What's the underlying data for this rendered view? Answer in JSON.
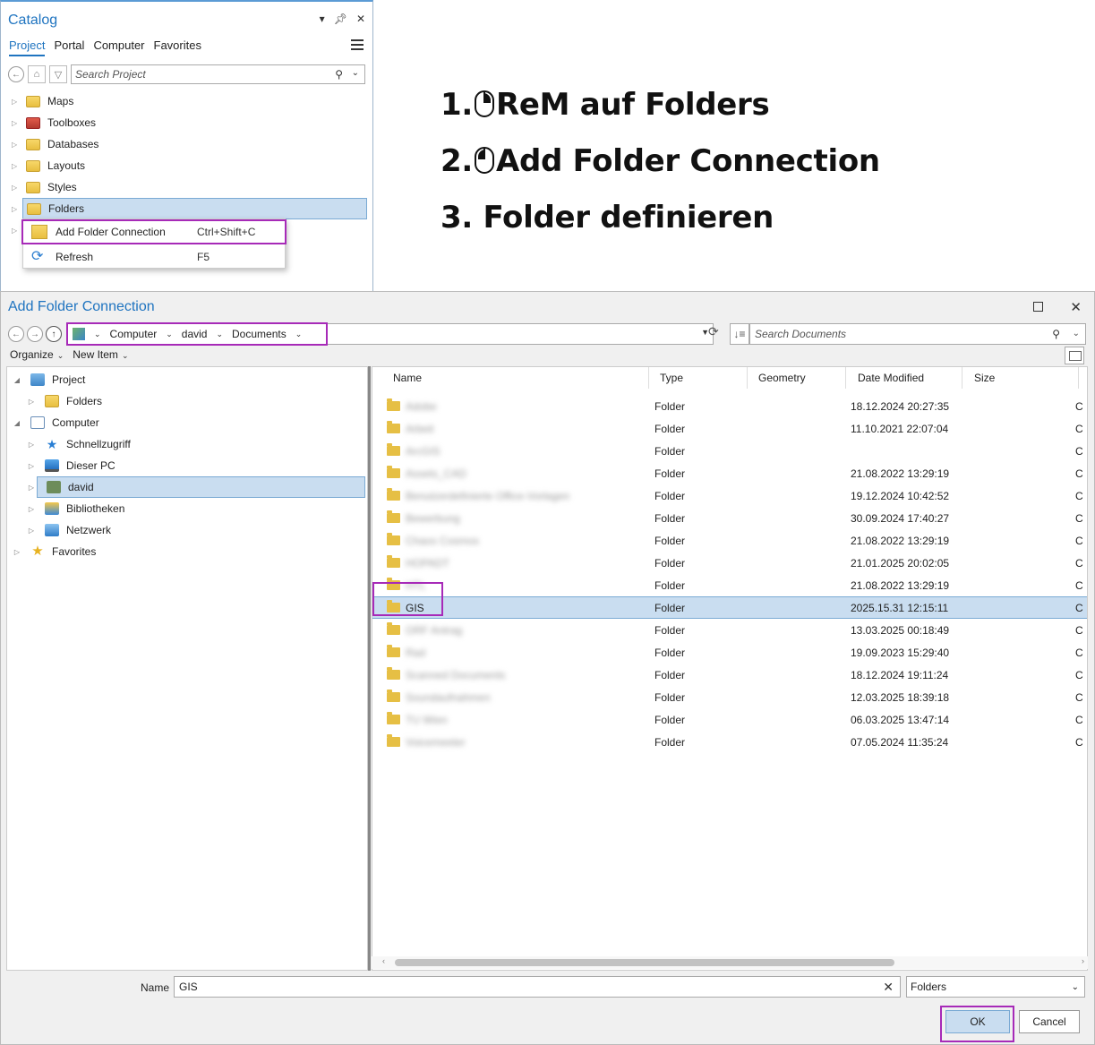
{
  "catalog": {
    "title": "Catalog",
    "tabs": [
      "Project",
      "Portal",
      "Computer",
      "Favorites"
    ],
    "search_placeholder": "Search Project",
    "items": [
      {
        "label": "Maps",
        "icon": "maps-folder-icon"
      },
      {
        "label": "Toolboxes",
        "icon": "toolboxes-folder-icon"
      },
      {
        "label": "Databases",
        "icon": "databases-folder-icon"
      },
      {
        "label": "Layouts",
        "icon": "layouts-folder-icon"
      },
      {
        "label": "Styles",
        "icon": "styles-folder-icon"
      },
      {
        "label": "Folders",
        "icon": "folders-folder-icon",
        "selected": true
      }
    ],
    "context_menu": [
      {
        "label": "Add Folder Connection",
        "shortcut": "Ctrl+Shift+C",
        "icon": "add-folder-icon",
        "highlighted": true
      },
      {
        "label": "Refresh",
        "shortcut": "F5",
        "icon": "refresh-icon"
      }
    ]
  },
  "instructions": {
    "step1": {
      "num": "1.",
      "text": "ReM auf Folders",
      "mouse": "right-click"
    },
    "step2": {
      "num": "2.",
      "text": "Add Folder Connection",
      "mouse": "left-click"
    },
    "step3": {
      "text": "3. Folder definieren"
    }
  },
  "dialog": {
    "title": "Add Folder Connection",
    "breadcrumb": [
      "Computer",
      "david",
      "Documents"
    ],
    "search_placeholder": "Search Documents",
    "toolbar": {
      "organize": "Organize",
      "new_item": "New Item"
    },
    "left_tree": [
      {
        "label": "Project",
        "level": 0,
        "expanded": true,
        "icon": "project-icon"
      },
      {
        "label": "Folders",
        "level": 1,
        "icon": "folder-icon"
      },
      {
        "label": "Computer",
        "level": 0,
        "expanded": true,
        "icon": "computer-icon"
      },
      {
        "label": "Schnellzugriff",
        "level": 1,
        "icon": "star-icon"
      },
      {
        "label": "Dieser PC",
        "level": 1,
        "icon": "pc-icon"
      },
      {
        "label": "david",
        "level": 1,
        "icon": "user-icon",
        "selected": true
      },
      {
        "label": "Bibliotheken",
        "level": 1,
        "icon": "library-icon"
      },
      {
        "label": "Netzwerk",
        "level": 1,
        "icon": "network-icon"
      },
      {
        "label": "Favorites",
        "level": 0,
        "icon": "favorites-star-icon"
      }
    ],
    "columns": [
      "Name",
      "Type",
      "Geometry",
      "Date Modified",
      "Size"
    ],
    "rows": [
      {
        "name": "Adobe",
        "type": "Folder",
        "date": "18.12.2024 20:27:35",
        "blurred": true
      },
      {
        "name": "Arbeit",
        "type": "Folder",
        "date": "11.10.2021 22:07:04",
        "blurred": true
      },
      {
        "name": "ArcGIS",
        "type": "Folder",
        "date": "",
        "blurred": true
      },
      {
        "name": "Assets_CAD",
        "type": "Folder",
        "date": "21.08.2022 13:29:19",
        "blurred": true
      },
      {
        "name": "Benutzerdefinierte Office-Vorlagen",
        "type": "Folder",
        "date": "19.12.2024 10:42:52",
        "blurred": true
      },
      {
        "name": "Bewerbung",
        "type": "Folder",
        "date": "30.09.2024 17:40:27",
        "blurred": true
      },
      {
        "name": "Chaos Cosmos",
        "type": "Folder",
        "date": "21.08.2022 13:29:19",
        "blurred": true
      },
      {
        "name": "HOPADT",
        "type": "Folder",
        "date": "21.01.2025 20:02:05",
        "blurred": true
      },
      {
        "name": "HTL",
        "type": "Folder",
        "date": "21.08.2022 13:29:19",
        "blurred": true
      },
      {
        "name": "GIS",
        "type": "Folder",
        "date": "2025.15.31 12:15:11",
        "selected": true
      },
      {
        "name": "ORF Antrag",
        "type": "Folder",
        "date": "13.03.2025 00:18:49",
        "blurred": true
      },
      {
        "name": "Rad",
        "type": "Folder",
        "date": "19.09.2023 15:29:40",
        "blurred": true
      },
      {
        "name": "Scanned Documents",
        "type": "Folder",
        "date": "18.12.2024 19:11:24",
        "blurred": true
      },
      {
        "name": "Soundaufnahmen",
        "type": "Folder",
        "date": "12.03.2025 18:39:18",
        "blurred": true
      },
      {
        "name": "TU Wien",
        "type": "Folder",
        "date": "06.03.2025 13:47:14",
        "blurred": true
      },
      {
        "name": "Voicemeeter",
        "type": "Folder",
        "date": "07.05.2024 11:35:24",
        "blurred": true
      }
    ],
    "extra_col_char": "C",
    "name_label": "Name",
    "name_value": "GIS",
    "type_filter": "Folders",
    "ok": "OK",
    "cancel": "Cancel",
    "highlight_color": "#a72ab8",
    "selection_color": "#c9ddf0"
  }
}
